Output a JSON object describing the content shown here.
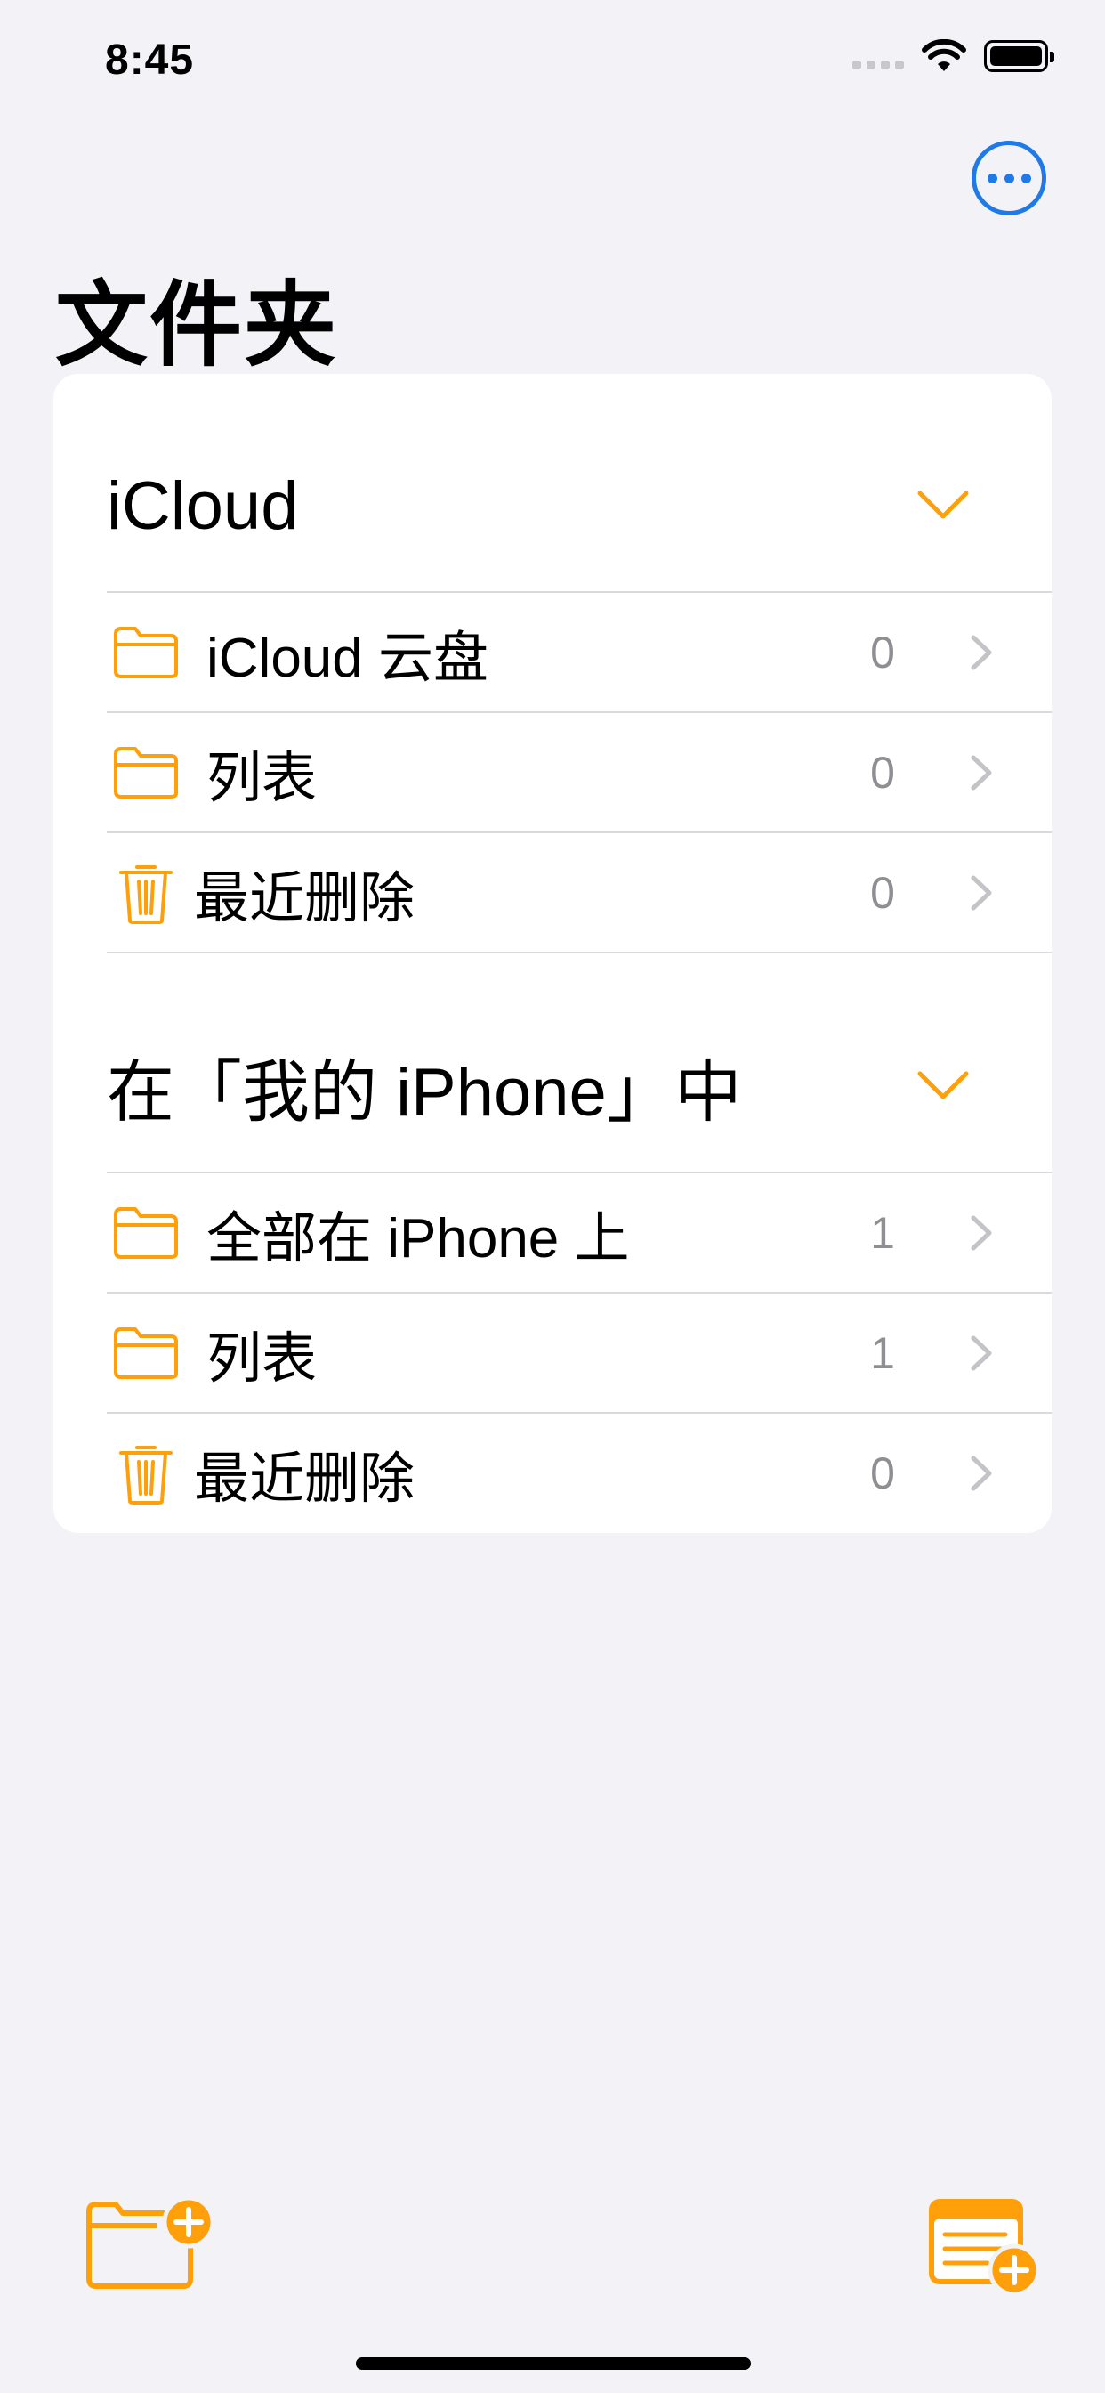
{
  "status_bar": {
    "time": "8:45"
  },
  "header": {
    "title": "文件夹"
  },
  "sections": [
    {
      "title": "iCloud",
      "items": [
        {
          "label": "iCloud 云盘",
          "count": "0",
          "icon": "folder-icon"
        },
        {
          "label": "列表",
          "count": "0",
          "icon": "folder-icon"
        },
        {
          "label": "最近删除",
          "count": "0",
          "icon": "trash-icon"
        }
      ]
    },
    {
      "title": "在「我的 iPhone」中",
      "items": [
        {
          "label": "全部在 iPhone 上",
          "count": "1",
          "icon": "folder-icon"
        },
        {
          "label": "列表",
          "count": "1",
          "icon": "folder-icon"
        },
        {
          "label": "最近删除",
          "count": "0",
          "icon": "trash-icon"
        }
      ]
    }
  ],
  "colors": {
    "accent": "#FF9F0A",
    "link_blue": "#1F7AE8",
    "background": "#F2F2F7"
  }
}
